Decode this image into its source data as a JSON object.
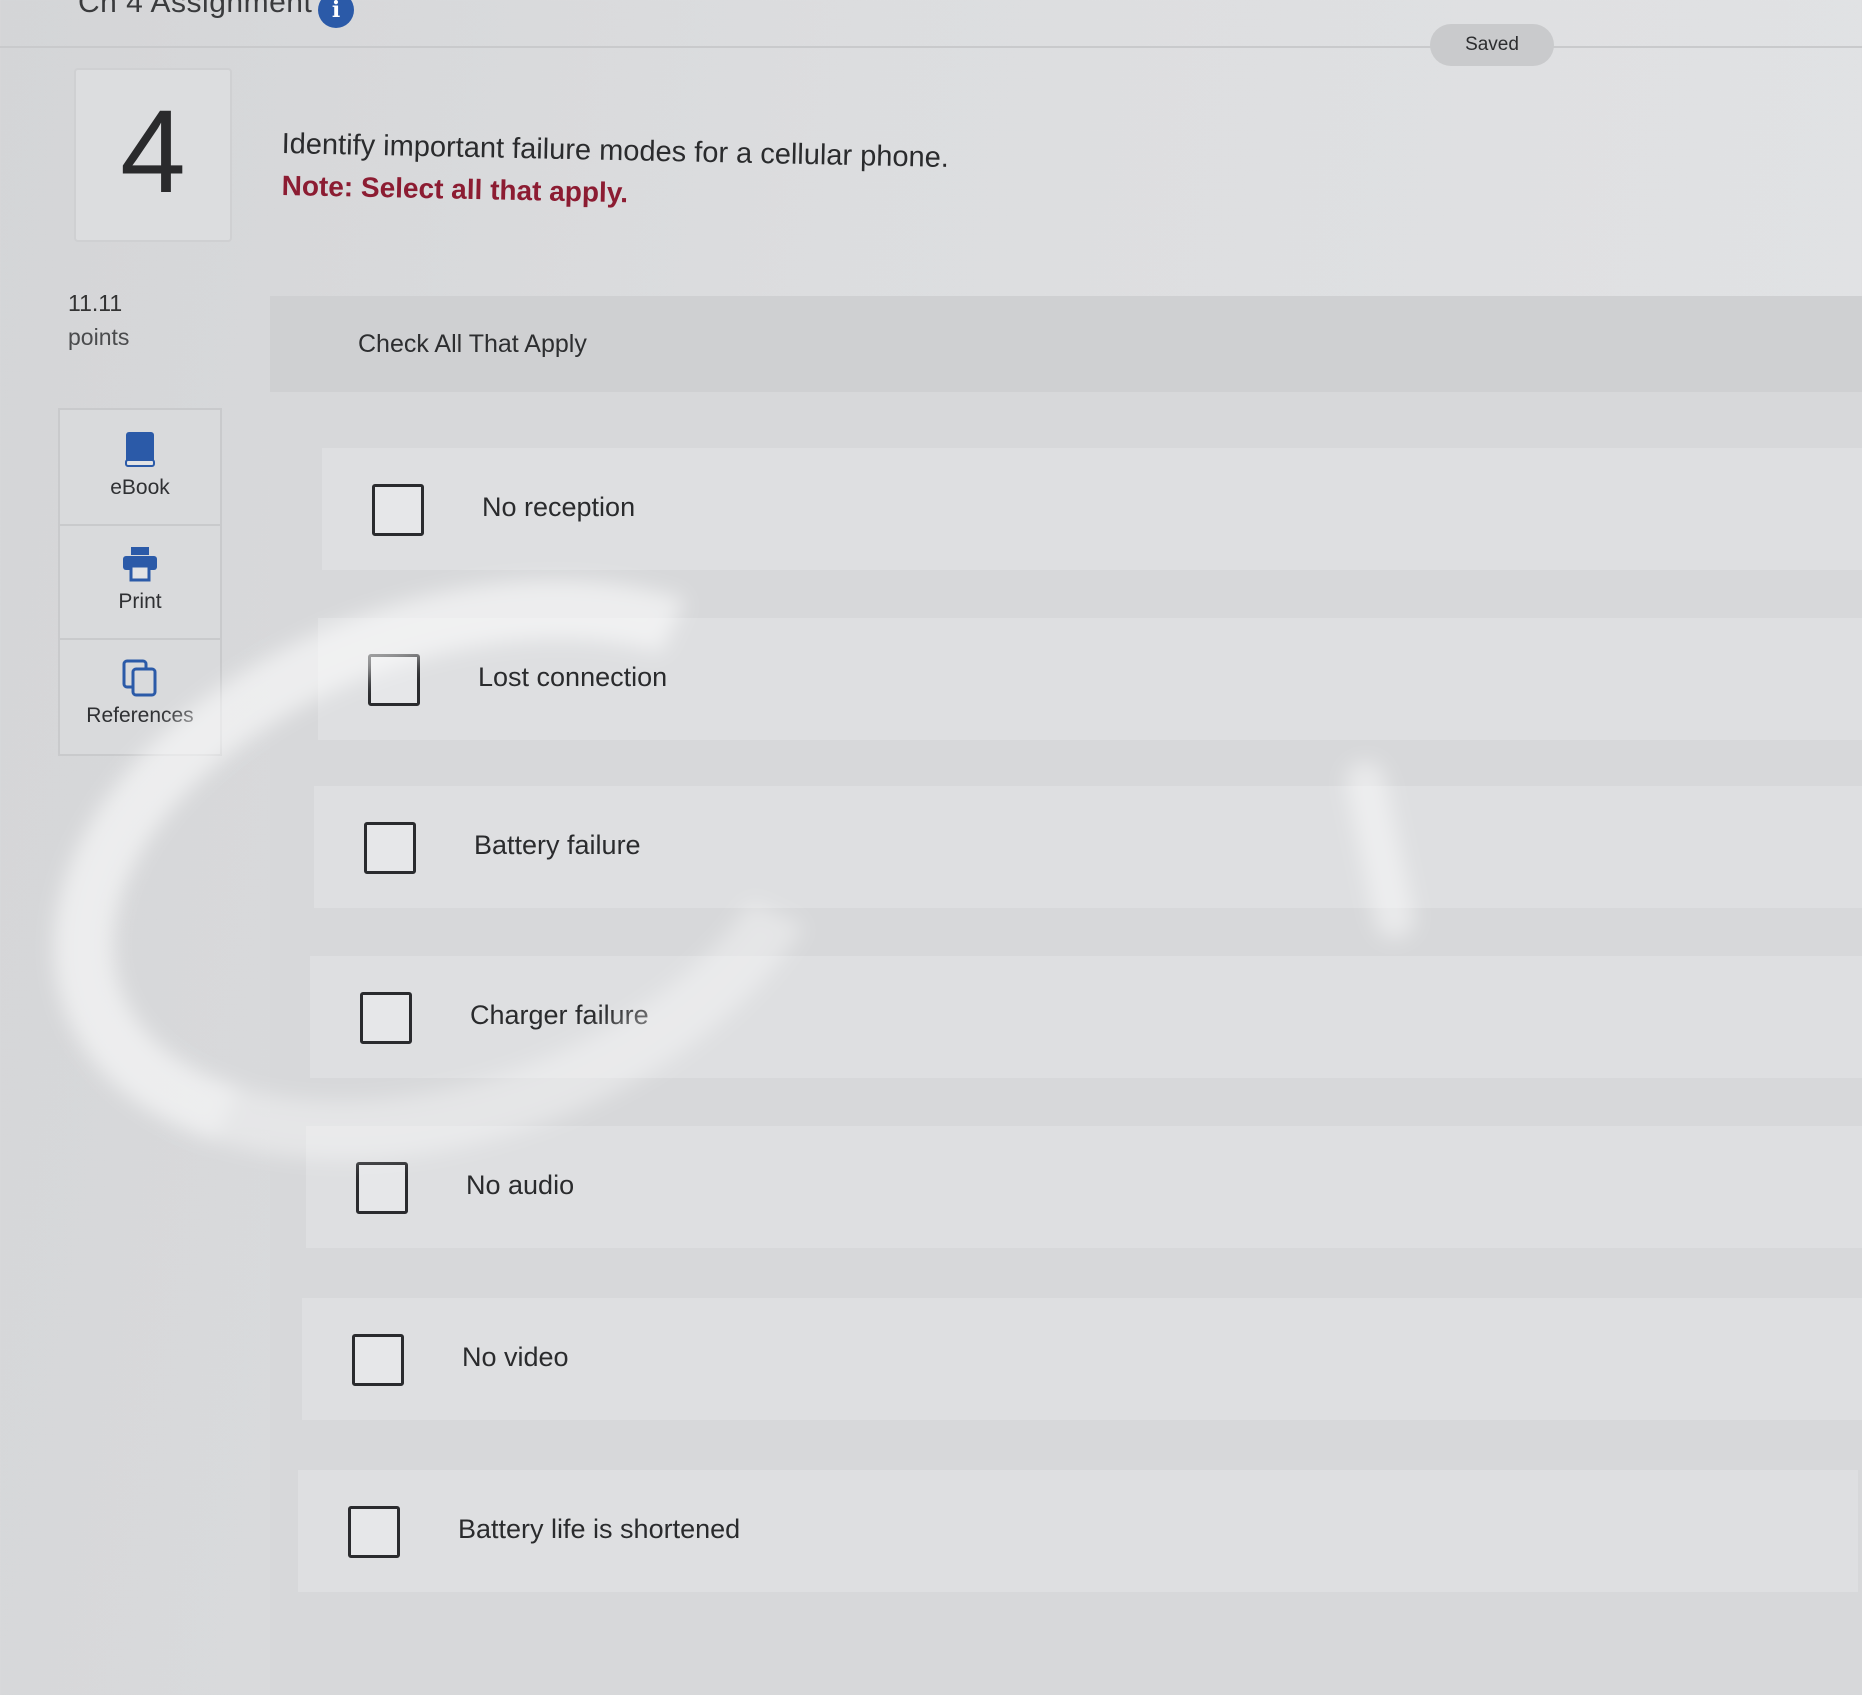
{
  "header": {
    "assignment_title": "Ch 4 Assignment",
    "info_icon": "info-icon",
    "saved_label": "Saved"
  },
  "question": {
    "number": "4",
    "text": "Identify important failure modes for a cellular phone.",
    "note": "Note: Select all that apply.",
    "points_value": "11.11",
    "points_label": "points"
  },
  "tools": [
    {
      "label": "eBook",
      "icon": "book-icon"
    },
    {
      "label": "Print",
      "icon": "printer-icon"
    },
    {
      "label": "References",
      "icon": "copy-icon"
    }
  ],
  "panel": {
    "header": "Check All That Apply",
    "options": [
      {
        "label": "No reception",
        "checked": false
      },
      {
        "label": "Lost connection",
        "checked": false
      },
      {
        "label": "Battery failure",
        "checked": false
      },
      {
        "label": "Charger failure",
        "checked": false
      },
      {
        "label": "No audio",
        "checked": false
      },
      {
        "label": "No video",
        "checked": false
      },
      {
        "label": "Battery life is shortened",
        "checked": false
      }
    ]
  },
  "colors": {
    "note_text": "#8c1c32",
    "info_icon_bg": "#2b5aa8",
    "tool_icon": "#2b5aa8"
  }
}
